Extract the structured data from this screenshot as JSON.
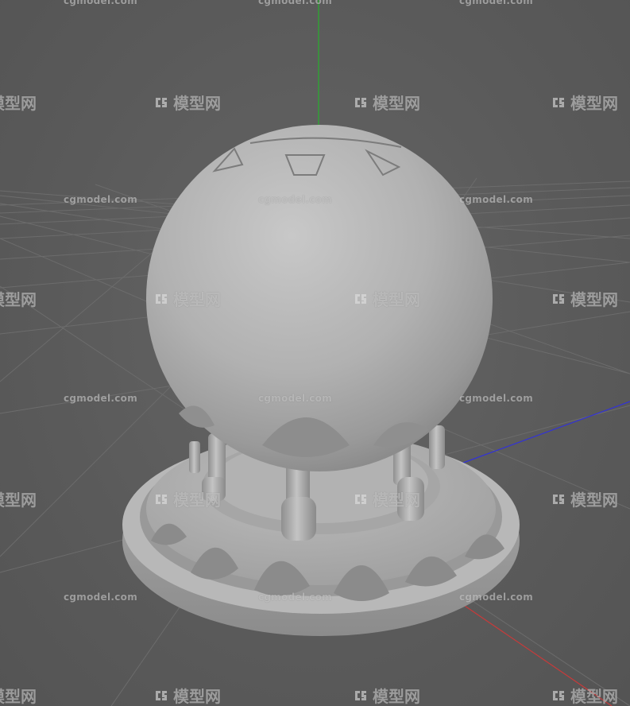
{
  "viewport": {
    "background_color": "#5d5d5d",
    "grid_color": "#6e6e6e",
    "axis_colors": {
      "y": "#27b02c",
      "z": "#3232d8",
      "x": "#c83a3a"
    }
  },
  "model": {
    "material_color": "#b4b4b4",
    "shadow_color": "#8a8a8a"
  },
  "watermark": {
    "url_text": "cgmodel.com",
    "logo_text": "模型网",
    "logo_icon": "cg-logo-icon"
  }
}
